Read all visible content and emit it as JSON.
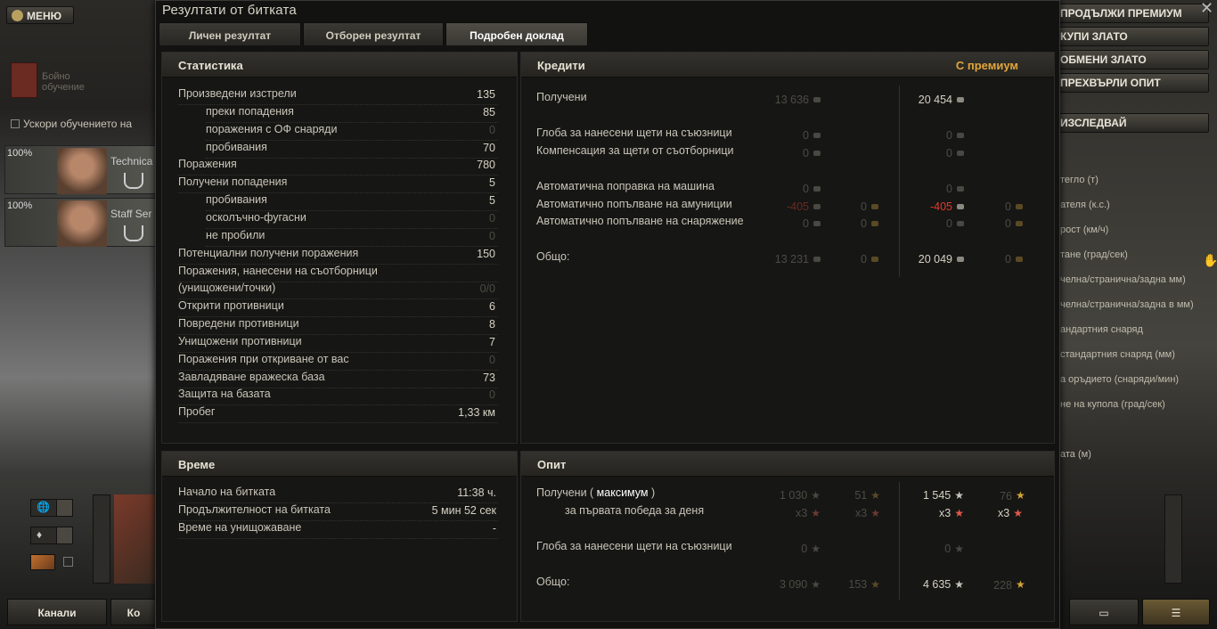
{
  "background": {
    "menu_label": "МЕНЮ",
    "training_label": "Бойно обучение",
    "accelerate_label": "Ускори обучението на",
    "crew": [
      {
        "pct": "100%",
        "name": "Technica"
      },
      {
        "pct": "100%",
        "name": "Staff Ser"
      }
    ],
    "bottom_left_button": "Канали",
    "bottom_left_button2": "Ко",
    "right_buttons": [
      "ПРОДЪЛЖИ ПРЕМИУМ",
      "КУПИ ЗЛАТО",
      "ОБМЕНИ ЗЛАТО",
      "ПРЕХВЪРЛИ ОПИТ",
      "ИЗСЛЕДВАЙ"
    ],
    "right_props": [
      "тегло (т)",
      "ателя (к.с.)",
      "рост (км/ч)",
      "тане (град/сек)",
      "челна/странична/задна мм)",
      "челна/странична/задна в мм)",
      "андартния снаряд",
      "стандартния снаряд (мм)",
      "а оръдието (снаряди/мин)",
      "не на купола (град/сек)",
      "ата (м)"
    ]
  },
  "window": {
    "title": "Резултати от битката",
    "tabs": [
      "Личен резултат",
      "Отборен резултат",
      "Подробен доклад"
    ],
    "active_tab": 2
  },
  "statistics": {
    "header": "Статистика",
    "rows": [
      {
        "label": "Произведени изстрели",
        "value": "135",
        "indent": false,
        "dim": false
      },
      {
        "label": "преки попадения",
        "value": "85",
        "indent": true,
        "dim": false
      },
      {
        "label": "поражения с ОФ снаряди",
        "value": "0",
        "indent": true,
        "dim": true
      },
      {
        "label": "пробивания",
        "value": "70",
        "indent": true,
        "dim": false
      },
      {
        "label": "Поражения",
        "value": "780",
        "indent": false,
        "dim": false
      },
      {
        "label": "Получени попадения",
        "value": "5",
        "indent": false,
        "dim": false
      },
      {
        "label": "пробивания",
        "value": "5",
        "indent": true,
        "dim": false
      },
      {
        "label": "осколъчно-фугасни",
        "value": "0",
        "indent": true,
        "dim": true
      },
      {
        "label": "не пробили",
        "value": "0",
        "indent": true,
        "dim": true
      },
      {
        "label": "Потенциални получени поражения",
        "value": "150",
        "indent": false,
        "dim": false
      },
      {
        "label": "Поражения, нанесени на съотборници",
        "value": "",
        "indent": false,
        "dim": false
      },
      {
        "label": "(унищожени/точки)",
        "value": "0/0",
        "indent": false,
        "dim": true
      },
      {
        "label": "Открити противници",
        "value": "6",
        "indent": false,
        "dim": false
      },
      {
        "label": "Повредени противници",
        "value": "8",
        "indent": false,
        "dim": false
      },
      {
        "label": "Унищожени противници",
        "value": "7",
        "indent": false,
        "dim": false
      },
      {
        "label": "Поражения при откриване от вас",
        "value": "0",
        "indent": false,
        "dim": true
      },
      {
        "label": "Завладяване вражеска база",
        "value": "73",
        "indent": false,
        "dim": false
      },
      {
        "label": "Защита на базата",
        "value": "0",
        "indent": false,
        "dim": true
      },
      {
        "label": "Пробег",
        "value": "1,33 км",
        "indent": false,
        "dim": false
      }
    ]
  },
  "credits": {
    "header": "Кредити",
    "premium_label": "С премиум",
    "rows": [
      {
        "label": "Получени",
        "c1": "13 636",
        "c2": "",
        "p1": "20 454",
        "p2": ""
      },
      {
        "label": "Глоба за нанесени щети на съюзници",
        "c1": "0",
        "c2": "",
        "p1": "0",
        "p2": ""
      },
      {
        "label": "Компенсация за щети от съотборници",
        "c1": "0",
        "c2": "",
        "p1": "0",
        "p2": ""
      },
      {
        "label": "Автоматична поправка на машина",
        "c1": "0",
        "c2": "",
        "p1": "0",
        "p2": ""
      },
      {
        "label": "Автоматично попълване на амуниции",
        "c1": "-405",
        "c2": "0",
        "p1": "-405",
        "p2": "0"
      },
      {
        "label": "Автоматично попълване на снаряжение",
        "c1": "0",
        "c2": "0",
        "p1": "0",
        "p2": "0"
      },
      {
        "label": "Общо:",
        "c1": "13 231",
        "c2": "0",
        "p1": "20 049",
        "p2": "0"
      }
    ]
  },
  "time": {
    "header": "Време",
    "rows": [
      {
        "label": "Начало на битката",
        "value": "11:38 ч."
      },
      {
        "label": "Продължителност на битката",
        "value": "5 мин 52 сек"
      },
      {
        "label": "Време на унищожаване",
        "value": "-"
      }
    ]
  },
  "experience": {
    "header": "Опит",
    "rows": [
      {
        "label": "Получени ( ",
        "label_highlight": "максимум",
        "label_end": " )",
        "c1": "1 030",
        "c2": "51",
        "p1": "1 545",
        "p2": "76"
      },
      {
        "label": "за първата победа за деня",
        "c1": "x3",
        "c2": "x3",
        "p1": "x3",
        "p2": "x3"
      },
      {
        "label": "Глоба за нанесени щети на съюзници",
        "c1": "0",
        "c2": "",
        "p1": "0",
        "p2": ""
      },
      {
        "label": "Общо:",
        "c1": "3 090",
        "c2": "153",
        "p1": "4 635",
        "p2": "228"
      }
    ]
  }
}
